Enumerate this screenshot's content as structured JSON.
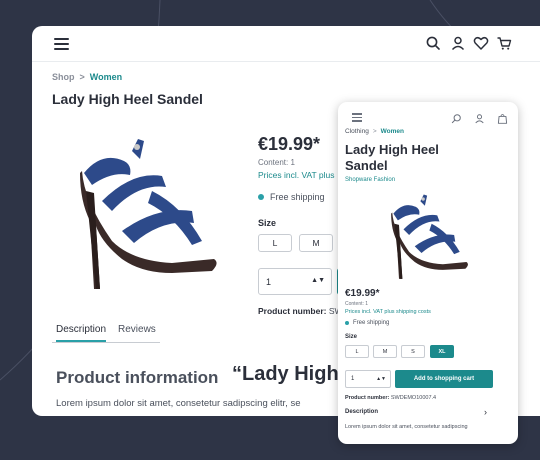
{
  "icons": {
    "menu": "hamburger-menu-icon",
    "search": "search-icon",
    "account": "user-icon",
    "wishlist": "heart-icon",
    "cart": "cart-icon"
  },
  "colors": {
    "background": "#2e3446",
    "accent": "#1c8a8c",
    "text": "#2b2f3a"
  },
  "desktop": {
    "breadcrumb": {
      "root": "Shop",
      "separator": ">",
      "current": "Women"
    },
    "title": "Lady High Heel Sandel",
    "price": "€19.99*",
    "content": "Content: 1",
    "vat": "Prices incl. VAT plus",
    "shipping": "Free shipping",
    "size_label": "Size",
    "sizes": [
      "L",
      "M"
    ],
    "quantity": "1",
    "product_number": {
      "label": "Product number:",
      "value": "SW"
    },
    "tabs": [
      {
        "label": "Description",
        "active": true
      },
      {
        "label": "Reviews",
        "active": false
      }
    ],
    "info_title": "Product information",
    "info_quote": "“Lady High",
    "lorem": "Lorem ipsum dolor sit amet, consetetur sadipscing elitr, se"
  },
  "mobile": {
    "breadcrumb": {
      "root": "Clothing",
      "separator": ">",
      "current": "Women"
    },
    "title": "Lady High Heel Sandel",
    "manufacturer": "Shopware Fashion",
    "price": "€19.99*",
    "content": "Content: 1",
    "vat": "Prices incl. VAT plus shipping costs",
    "shipping": "Free shipping",
    "size_label": "Size",
    "sizes": [
      "L",
      "M",
      "S",
      "XL"
    ],
    "selected_size": "XL",
    "quantity": "1",
    "add_to_cart": "Add to shopping cart",
    "product_number": {
      "label": "Product number:",
      "value": "SWDEMO10007.4"
    },
    "description_label": "Description",
    "lorem": "Lorem ipsum dolor sit amet, consetetur sadipscing"
  }
}
